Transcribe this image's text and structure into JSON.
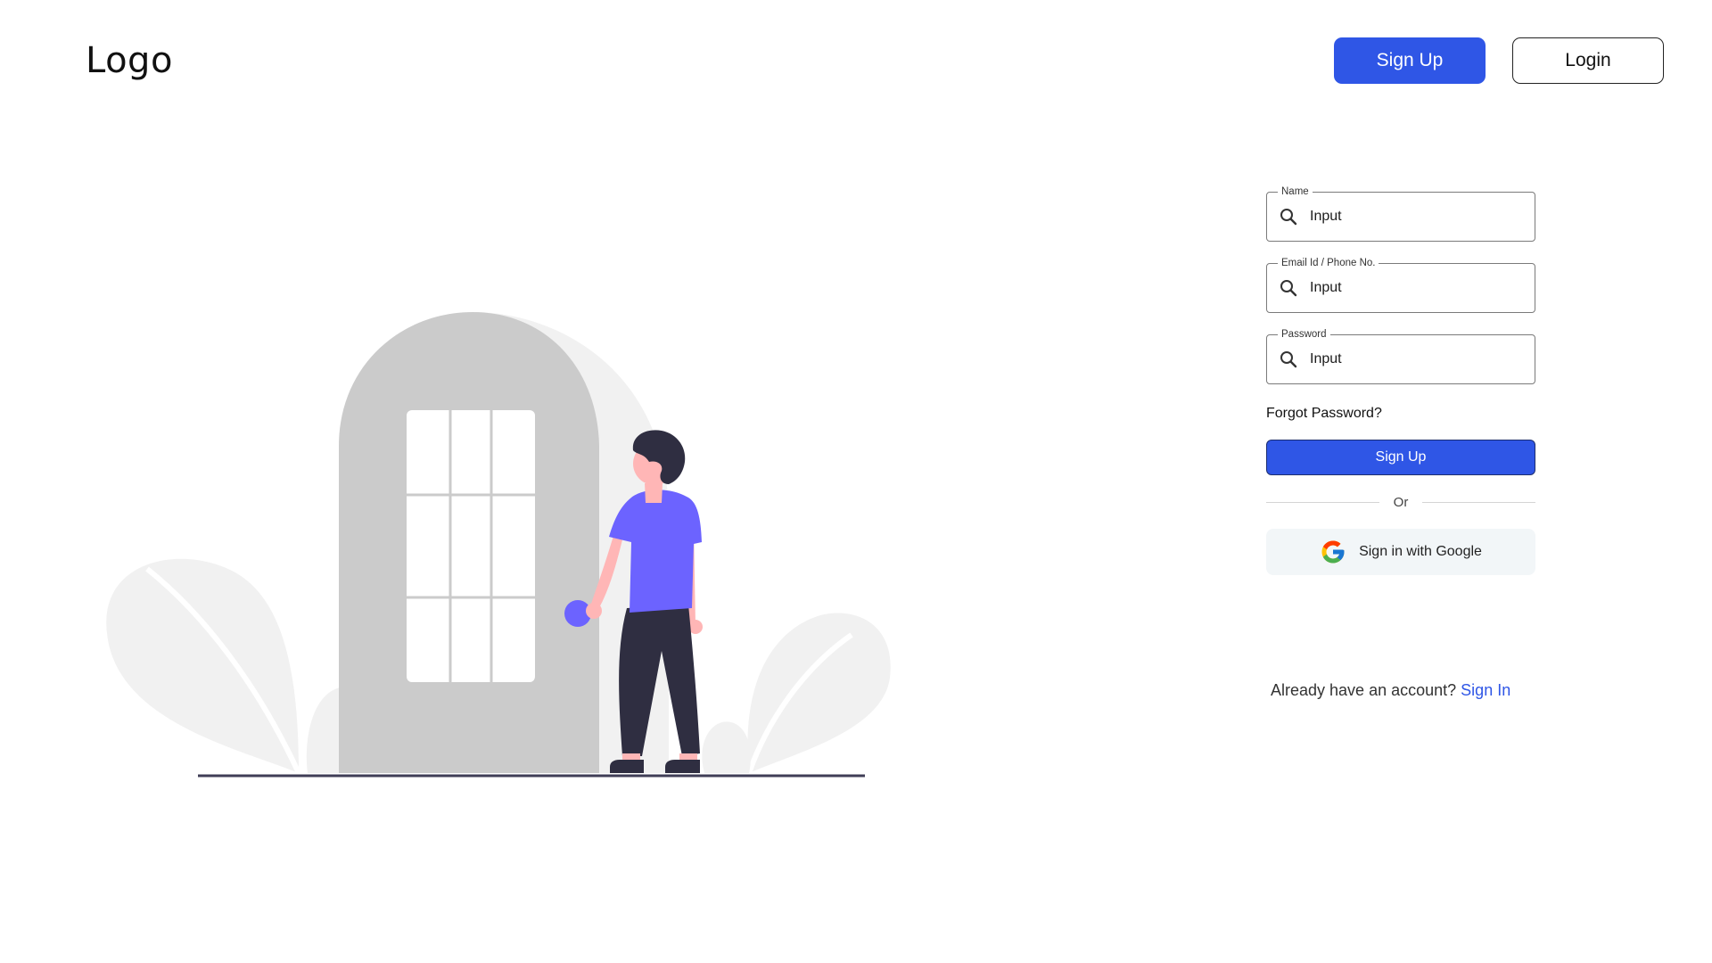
{
  "header": {
    "logo": "Logo",
    "signup_label": "Sign Up",
    "login_label": "Login"
  },
  "form": {
    "fields": [
      {
        "label": "Name",
        "value": "Input",
        "icon": "search-icon"
      },
      {
        "label": "Email Id / Phone No.",
        "value": "Input",
        "icon": "search-icon"
      },
      {
        "label": "Password",
        "value": "Input",
        "icon": "search-icon"
      }
    ],
    "forgot_label": "Forgot Password?",
    "submit_label": "Sign Up",
    "divider_label": "Or",
    "google_label": "Sign in with Google",
    "google_icon": "google-logo-icon"
  },
  "footer": {
    "prompt": "Already have an account?",
    "link_label": "Sign In"
  },
  "colors": {
    "primary": "#2f56e6",
    "illustration_accent": "#6c63ff",
    "door": "#cbcbcb",
    "foliage": "#f1f1f1"
  }
}
